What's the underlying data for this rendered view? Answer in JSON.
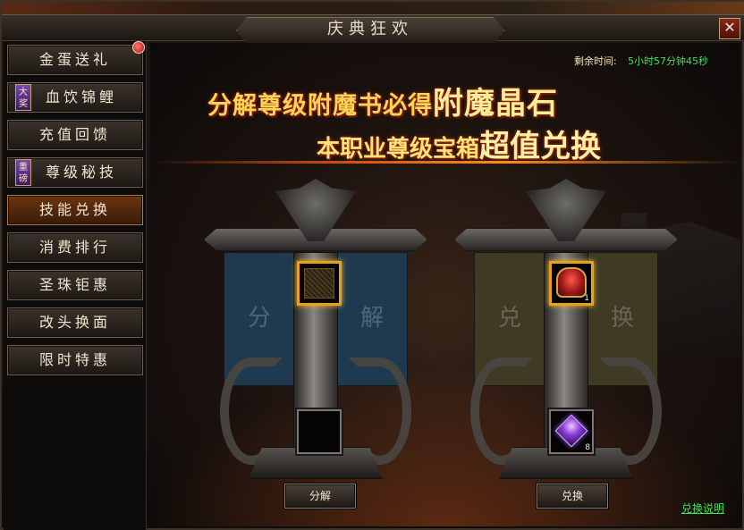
{
  "window": {
    "title": "庆典狂欢",
    "close_label": "✕"
  },
  "sidebar": {
    "items": [
      {
        "label": "金蛋送礼",
        "badge": "",
        "has_dot": true
      },
      {
        "label": "血饮锦鲤",
        "badge": "大奖"
      },
      {
        "label": "充值回馈",
        "badge": ""
      },
      {
        "label": "尊级秘技",
        "badge": "重磅"
      },
      {
        "label": "技能兑换",
        "badge": "",
        "active": true
      },
      {
        "label": "消费排行",
        "badge": ""
      },
      {
        "label": "圣珠钜惠",
        "badge": ""
      },
      {
        "label": "改头换面",
        "badge": ""
      },
      {
        "label": "限时特惠",
        "badge": ""
      }
    ]
  },
  "main": {
    "timer_label": "剩余时间:",
    "timer_value": "5小时57分钟45秒",
    "banner_line1_normal": "分解尊级附魔书必得",
    "banner_line1_big": "附魔晶石",
    "banner_line2_normal": "本职业尊级宝箱",
    "banner_line2_big": "超值兑换",
    "decompose": {
      "left_char": "分",
      "right_char": "解",
      "button_label": "分解",
      "cloth_color": "#1f3a4e"
    },
    "exchange": {
      "left_char": "兑",
      "right_char": "换",
      "button_label": "兑换",
      "cloth_color": "#3e3a24",
      "top_item_count": "1",
      "bottom_item_count": "8"
    },
    "help_link": "兑换说明"
  },
  "colors": {
    "accent_gold": "#e8a21a",
    "timer_green": "#3fe05a",
    "banner_yellow": "#ffd25a"
  },
  "icons": {
    "close": "close-icon",
    "book": "enchant-book-icon",
    "helm": "treasure-chest-icon",
    "gem": "enchant-crystal-icon"
  }
}
